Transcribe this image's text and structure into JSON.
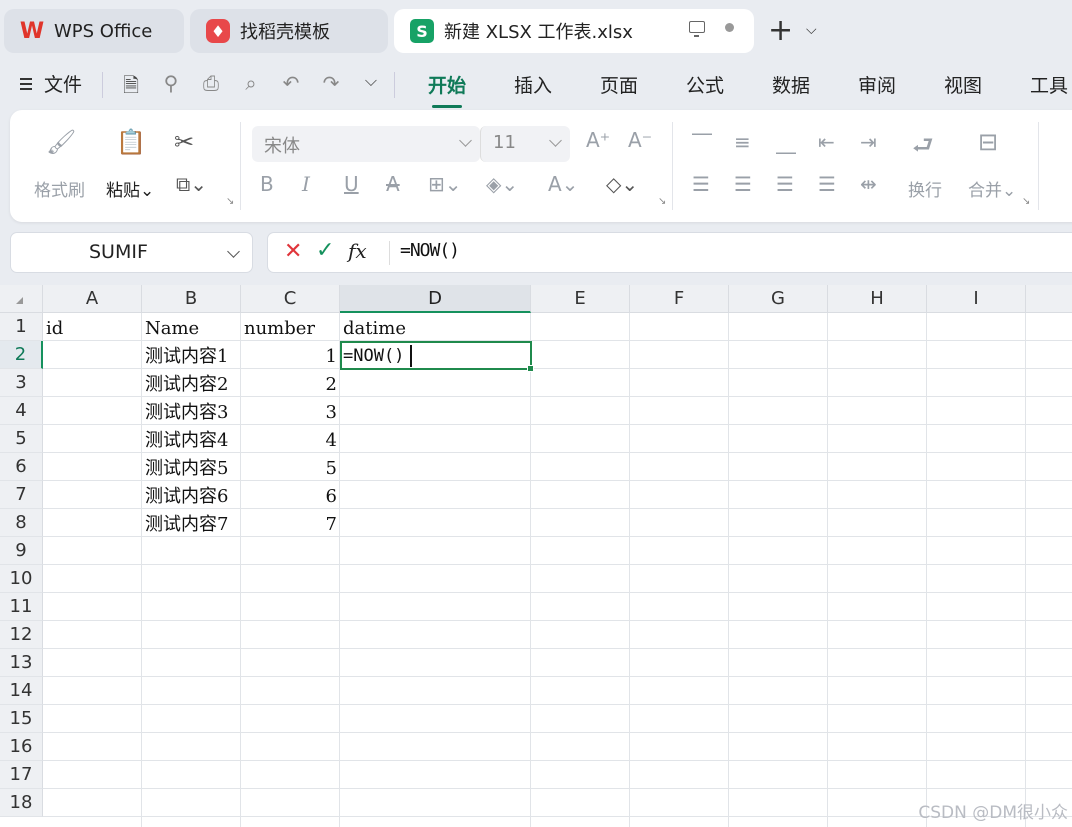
{
  "tabs": [
    {
      "label": "WPS Office",
      "icon": "wps-logo-icon"
    },
    {
      "label": "找稻壳模板",
      "icon": "docer-icon"
    },
    {
      "label": "新建 XLSX 工作表.xlsx",
      "icon": "spreadsheet-icon"
    }
  ],
  "menu": {
    "file_label": "文件",
    "tabs": [
      "开始",
      "插入",
      "页面",
      "公式",
      "数据",
      "审阅",
      "视图",
      "工具"
    ],
    "active_tab": "开始"
  },
  "ribbon": {
    "format_painter": "格式刷",
    "paste": "粘贴",
    "font_name": "宋体",
    "font_size": "11",
    "wrap": "换行",
    "merge": "合并"
  },
  "formula_bar": {
    "name_box": "SUMIF",
    "formula": "=NOW()"
  },
  "sheet": {
    "columns": [
      "A",
      "B",
      "C",
      "D",
      "E",
      "F",
      "G",
      "H",
      "I"
    ],
    "rows": [
      "1",
      "2",
      "3",
      "4",
      "5",
      "6",
      "7",
      "8",
      "9",
      "10",
      "11",
      "12",
      "13",
      "14",
      "15",
      "16",
      "17",
      "18"
    ],
    "selected_column": "D",
    "selected_row": "2",
    "header_row": [
      "id",
      "Name",
      "number",
      "datime"
    ],
    "data": [
      {
        "name": "测试内容1",
        "number": "1",
        "datime": "=NOW()"
      },
      {
        "name": "测试内容2",
        "number": "2",
        "datime": ""
      },
      {
        "name": "测试内容3",
        "number": "3",
        "datime": ""
      },
      {
        "name": "测试内容4",
        "number": "4",
        "datime": ""
      },
      {
        "name": "测试内容5",
        "number": "5",
        "datime": ""
      },
      {
        "name": "测试内容6",
        "number": "6",
        "datime": ""
      },
      {
        "name": "测试内容7",
        "number": "7",
        "datime": ""
      }
    ]
  },
  "watermark": "CSDN @DM很小众",
  "colors": {
    "accent": "#0f7a58",
    "selection": "#1f8a4c",
    "cancel": "#e0353b"
  }
}
